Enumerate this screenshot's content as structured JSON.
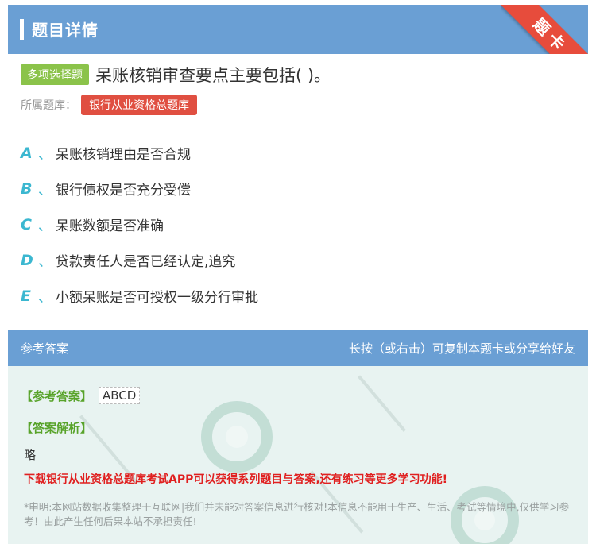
{
  "header": {
    "title": "题目详情",
    "ribbon": "题卡"
  },
  "question": {
    "type": "多项选择题",
    "text": "呆账核销审查要点主要包括( )。",
    "bank_label": "所属题库：",
    "bank": "银行从业资格总题库"
  },
  "options": [
    {
      "letter": "A",
      "sep": "、",
      "text": "呆账核销理由是否合规"
    },
    {
      "letter": "B",
      "sep": "、",
      "text": "银行债权是否充分受偿"
    },
    {
      "letter": "C",
      "sep": "、",
      "text": "呆账数额是否准确"
    },
    {
      "letter": "D",
      "sep": "、",
      "text": "贷款责任人是否已经认定,追究"
    },
    {
      "letter": "E",
      "sep": "、",
      "text": "小额呆账是否可授权一级分行审批"
    }
  ],
  "answer": {
    "head_left": "参考答案",
    "head_right": "长按（或右击）可复制本题卡或分享给好友",
    "answer_label": "【参考答案】",
    "answer_value": "ABCD",
    "explain_label": "【答案解析】",
    "explain_text": "略",
    "promo": "下载银行从业资格总题库考试APP可以获得系列题目与答案,还有练习等更多学习功能!",
    "disclaimer": "*申明:本网站数据收集整理于互联网|我们并未能对答案信息进行核对!本信息不能用于生产、生活、考试等情境中,仅供学习参考！由此产生任何后果本站不承担责任!"
  },
  "colors": {
    "header_blue": "#6a9fd4",
    "badge_green": "#8bc34a",
    "badge_red": "#e04f41",
    "option_cyan": "#3bb7d0",
    "promo_red": "#e02020"
  }
}
